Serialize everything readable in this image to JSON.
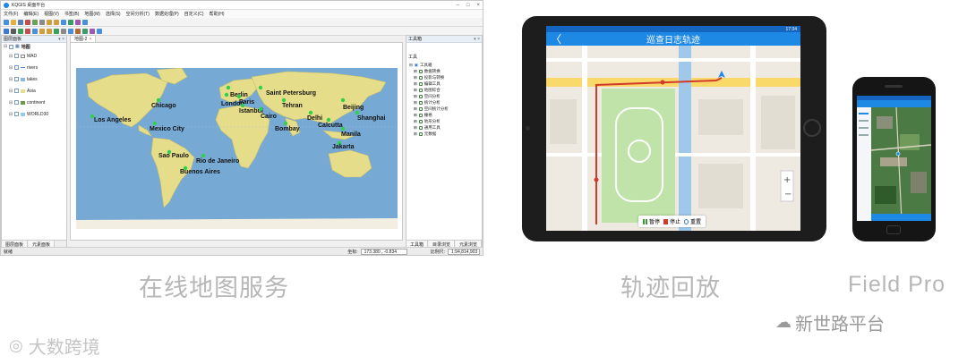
{
  "desktop": {
    "title": "KQGIS 桌面平台",
    "menu": [
      "文件(F)",
      "编辑(E)",
      "视图(V)",
      "书签(B)",
      "地图(M)",
      "选择(S)",
      "空间分析(T)",
      "数据处理(P)",
      "自定义(C)",
      "帮助(H)"
    ],
    "left_panel_title": "图层面板",
    "map_root": "地图",
    "layers": [
      "MAD",
      "rivers",
      "lakes",
      "Asia",
      "continent",
      "WORLD30"
    ],
    "left_tabs": [
      "图层面板",
      "元素面板"
    ],
    "map_tab": "地图-2",
    "cities": [
      "Berlin",
      "Saint Petersburg",
      "London",
      "Paris",
      "Tehran",
      "Istanbul",
      "Beijing",
      "Chicago",
      "Cairo",
      "Shanghai",
      "Delhi",
      "Los Angeles",
      "Mexico City",
      "Bombay",
      "Calcutta",
      "Manila",
      "Jakarta",
      "Sao Paulo",
      "Rio de Janeiro",
      "Buenos Aires"
    ],
    "toolbox_title": "工具箱",
    "toolbox_root_label": "工具",
    "toolbox_root": "工具箱",
    "toolbox_items": [
      "数据转换",
      "投影与转换",
      "编辑工具",
      "地图综合",
      "空间分析",
      "统计分析",
      "空间统计分析",
      "栅格",
      "地形分析",
      "通用工具",
      "元数据"
    ],
    "right_tabs": [
      "工具箱",
      "目录浏览",
      "元素浏览"
    ],
    "status": {
      "left": "就绪",
      "coord_label": "坐标:",
      "coord_value": "173.380 , -0.834",
      "scale_label": "比例尺:",
      "scale_value": "1:94,814,903"
    }
  },
  "captions": {
    "desktop": "在线地图服务",
    "tablet": "轨迹回放",
    "phone": "Field Pro"
  },
  "tablet": {
    "time": "17:34",
    "title": "巡查日志轨迹",
    "back": "〈",
    "controls": [
      "暂停",
      "停止",
      "重置"
    ]
  },
  "watermarks": {
    "right": "新世路平台",
    "left": "大数跨境"
  },
  "colors": {
    "ocean": "#76a9d4",
    "land": "#e6dd8a",
    "city": "#2fd04a",
    "tablet_bar": "#1e88e5",
    "track": "#d23a2a",
    "caption": "#b7b7b7"
  }
}
